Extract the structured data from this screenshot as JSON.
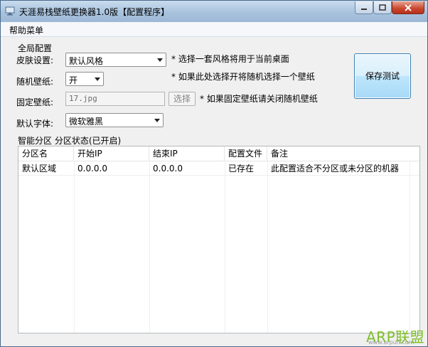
{
  "window": {
    "title": "天涯易栈壁纸更换器1.0版【配置程序】"
  },
  "menu": {
    "help": "帮助菜单"
  },
  "global_config": {
    "section_title": "全局配置",
    "skin_label": "皮肤设置:",
    "skin_value": "默认风格",
    "skin_note": "* 选择一套风格将用于当前桌面",
    "random_label": "随机壁纸:",
    "random_value": "开",
    "random_note": "* 如果此处选择开将随机选择一个壁纸",
    "fixed_label": "固定壁纸:",
    "fixed_value": "17.jpg",
    "choose_button": "选择",
    "fixed_note": "* 如果固定壁纸请关闭随机壁纸",
    "font_label": "默认字体:",
    "font_value": "微软雅黑",
    "save_button": "保存测试"
  },
  "partition": {
    "title": "智能分区 分区状态(已开启)",
    "columns": [
      "分区名",
      "开始IP",
      "结束IP",
      "配置文件",
      "备注"
    ],
    "rows": [
      [
        "默认区域",
        "0.0.0.0",
        "0.0.0.0",
        "已存在",
        "此配置适合不分区或未分区的机器"
      ]
    ]
  },
  "watermark": {
    "brand": "ARP联盟",
    "url": "www.arpun.com"
  }
}
